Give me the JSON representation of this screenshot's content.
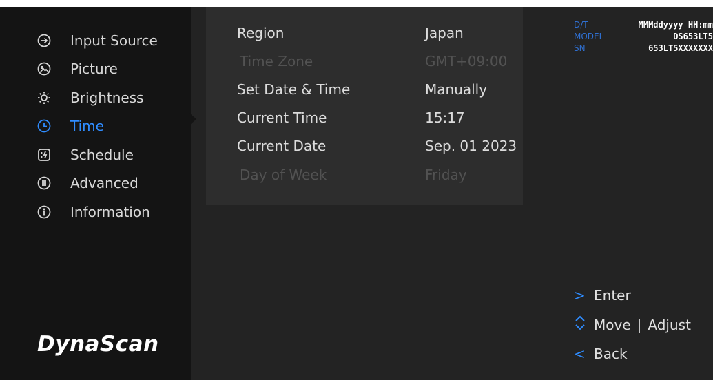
{
  "menu": {
    "items": [
      {
        "label": "Input Source",
        "icon": "input-source-icon",
        "active": false
      },
      {
        "label": "Picture",
        "icon": "picture-icon",
        "active": false
      },
      {
        "label": "Brightness",
        "icon": "brightness-icon",
        "active": false
      },
      {
        "label": "Time",
        "icon": "clock-icon",
        "active": true
      },
      {
        "label": "Schedule",
        "icon": "schedule-icon",
        "active": false
      },
      {
        "label": "Advanced",
        "icon": "advanced-icon",
        "active": false
      },
      {
        "label": "Information",
        "icon": "info-icon",
        "active": false
      }
    ]
  },
  "brand": {
    "logo_text": "DynaScan"
  },
  "settings": {
    "rows": [
      {
        "label": "Region",
        "value": "Japan",
        "enabled": true
      },
      {
        "label": "Time Zone",
        "value": "GMT+09:00",
        "enabled": false
      },
      {
        "label": "Set Date & Time",
        "value": "Manually",
        "enabled": true
      },
      {
        "label": "Current Time",
        "value": "15:17",
        "enabled": true
      },
      {
        "label": "Current Date",
        "value": "Sep. 01 2023",
        "enabled": true
      },
      {
        "label": "Day of Week",
        "value": "Friday",
        "enabled": false
      }
    ]
  },
  "device_info": {
    "dt_label": "D/T",
    "dt_value": "MMMddyyyy HH:mm",
    "model_label": "MODEL",
    "model_value": "DS653LT5",
    "sn_label": "SN",
    "sn_value": "653LT5XXXXXXX"
  },
  "help": {
    "enter_glyph": ">",
    "enter": "Enter",
    "move": "Move",
    "separator": "|",
    "adjust": "Adjust",
    "back_glyph": "<",
    "back": "Back"
  },
  "colors": {
    "accent": "#2f8cff",
    "sidebar": "#141414",
    "panel": "#2d2d2d",
    "background": "#232323"
  }
}
